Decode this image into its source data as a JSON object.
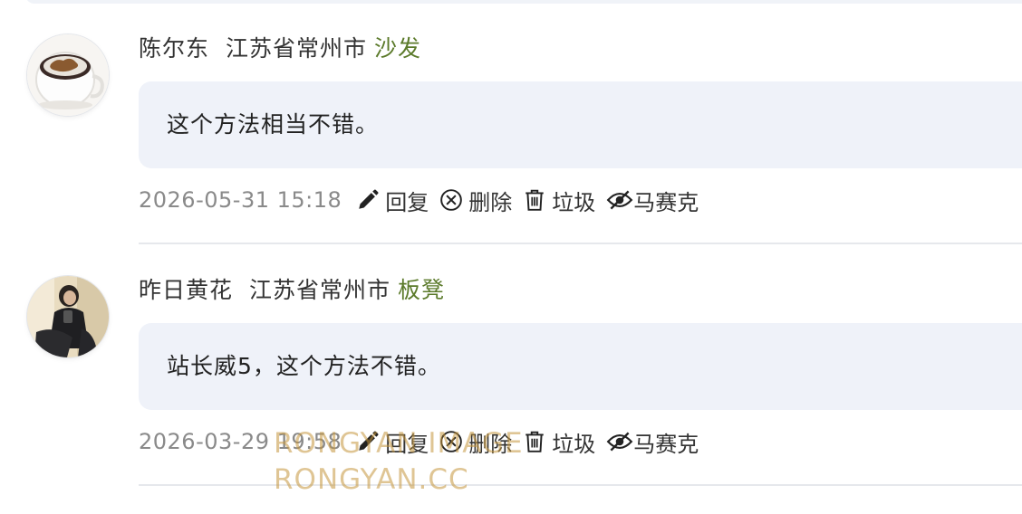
{
  "comments": [
    {
      "author": "陈尔东",
      "location": "江苏省常州市",
      "rank": "沙发",
      "text": "这个方法相当不错。",
      "time": "2026-05-31 15:18",
      "actions": {
        "reply": "回复",
        "delete": "删除",
        "spam": "垃圾",
        "mosaic": "马赛克"
      }
    },
    {
      "author": "昨日黄花",
      "location": "江苏省常州市",
      "rank": "板凳",
      "text": "站长威5，这个方法不错。",
      "time": "2026-03-29 19:58",
      "actions": {
        "reply": "回复",
        "delete": "删除",
        "spam": "垃圾",
        "mosaic": "马赛克"
      }
    }
  ],
  "watermark": {
    "line1": "RONGYAN IMAGE",
    "line2": "RONGYAN.CC"
  },
  "icons": [
    "pencil-icon",
    "circle-x-icon",
    "trash-icon",
    "eye-slash-icon"
  ],
  "colors": {
    "rank": "#5b7a2a",
    "bubble": "#eff2f9",
    "time": "#8a8a8a"
  }
}
